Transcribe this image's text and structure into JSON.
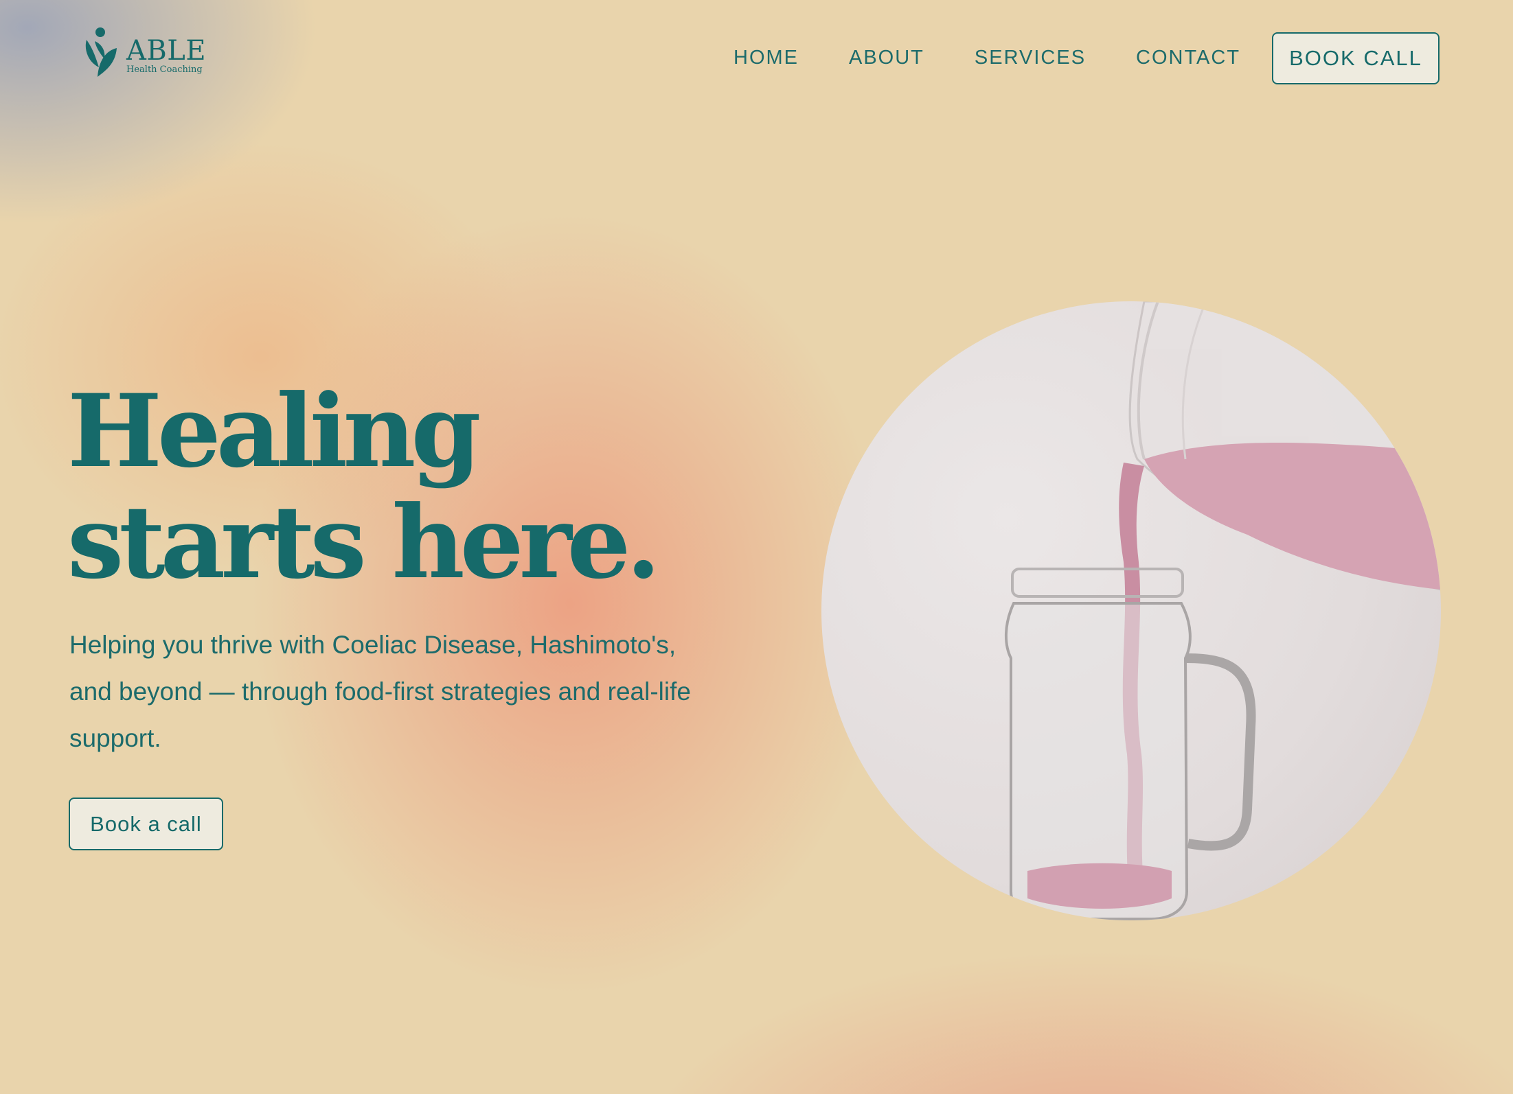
{
  "brand": {
    "name": "ABLE",
    "tagline": "Health Coaching",
    "logo_icon": "leaf-person-icon"
  },
  "nav": {
    "items": [
      {
        "label": "HOME"
      },
      {
        "label": "ABOUT"
      },
      {
        "label": "SERVICES"
      },
      {
        "label": "CONTACT"
      }
    ],
    "cta_label": "BOOK CALL"
  },
  "hero": {
    "headline_line1": "Healing",
    "headline_line2": "starts here.",
    "subtext": "Helping you thrive with Coeliac Disease, Hashimoto's, and beyond — through food-first strategies and real-life support.",
    "cta_label": "Book a call",
    "image": "smoothie-pouring-into-jar-photo"
  },
  "colors": {
    "primary": "#166a6a",
    "background": "#e9d4ac",
    "button_fill": "#eeebdf"
  }
}
